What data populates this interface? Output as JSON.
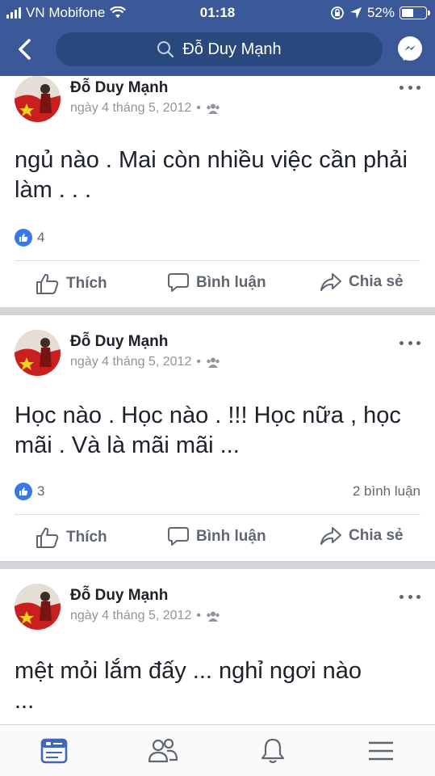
{
  "status_bar": {
    "carrier": "VN Mobifone",
    "time": "01:18",
    "battery": "52%",
    "battery_level": 0.52,
    "icons": [
      "signal-icon",
      "wifi-icon",
      "orientation-lock-icon",
      "location-arrow-icon",
      "battery-icon"
    ]
  },
  "nav": {
    "search_text": "Đỗ Duy Mạnh",
    "icons": [
      "back-chevron-icon",
      "search-icon",
      "messenger-icon"
    ]
  },
  "posts": [
    {
      "author": "Đỗ Duy Mạnh",
      "date": "ngày 4 tháng 5, 2012",
      "dot": "•",
      "text": "ngủ nào . Mai còn nhiều việc cần phải làm . . .",
      "likes": "4",
      "comments": ""
    },
    {
      "author": "Đỗ Duy Mạnh",
      "date": "ngày 4 tháng 5, 2012",
      "dot": "•",
      "text": "Học nào . Học nào . !!! Học nữa , học mãi . Và là mãi mãi ...",
      "likes": "3",
      "comments": "2 bình luận"
    },
    {
      "author": "Đỗ Duy Mạnh",
      "date": "ngày 4 tháng 5, 2012",
      "dot": "•",
      "text": "mệt mỏi lắm đấy ... nghỉ ngơi nào ...",
      "likes": "",
      "comments": ""
    }
  ],
  "actions": {
    "like": "Thích",
    "comment": "Bình luận",
    "share": "Chia sẻ"
  },
  "tabbar": {
    "icons": [
      "news-feed-icon",
      "friends-icon",
      "notifications-bell-icon",
      "menu-icon"
    ],
    "active_color": "#4267b2",
    "inactive_color": "#606770"
  },
  "colors": {
    "brand": "#3b5998",
    "like_blue": "#3b78e7"
  }
}
